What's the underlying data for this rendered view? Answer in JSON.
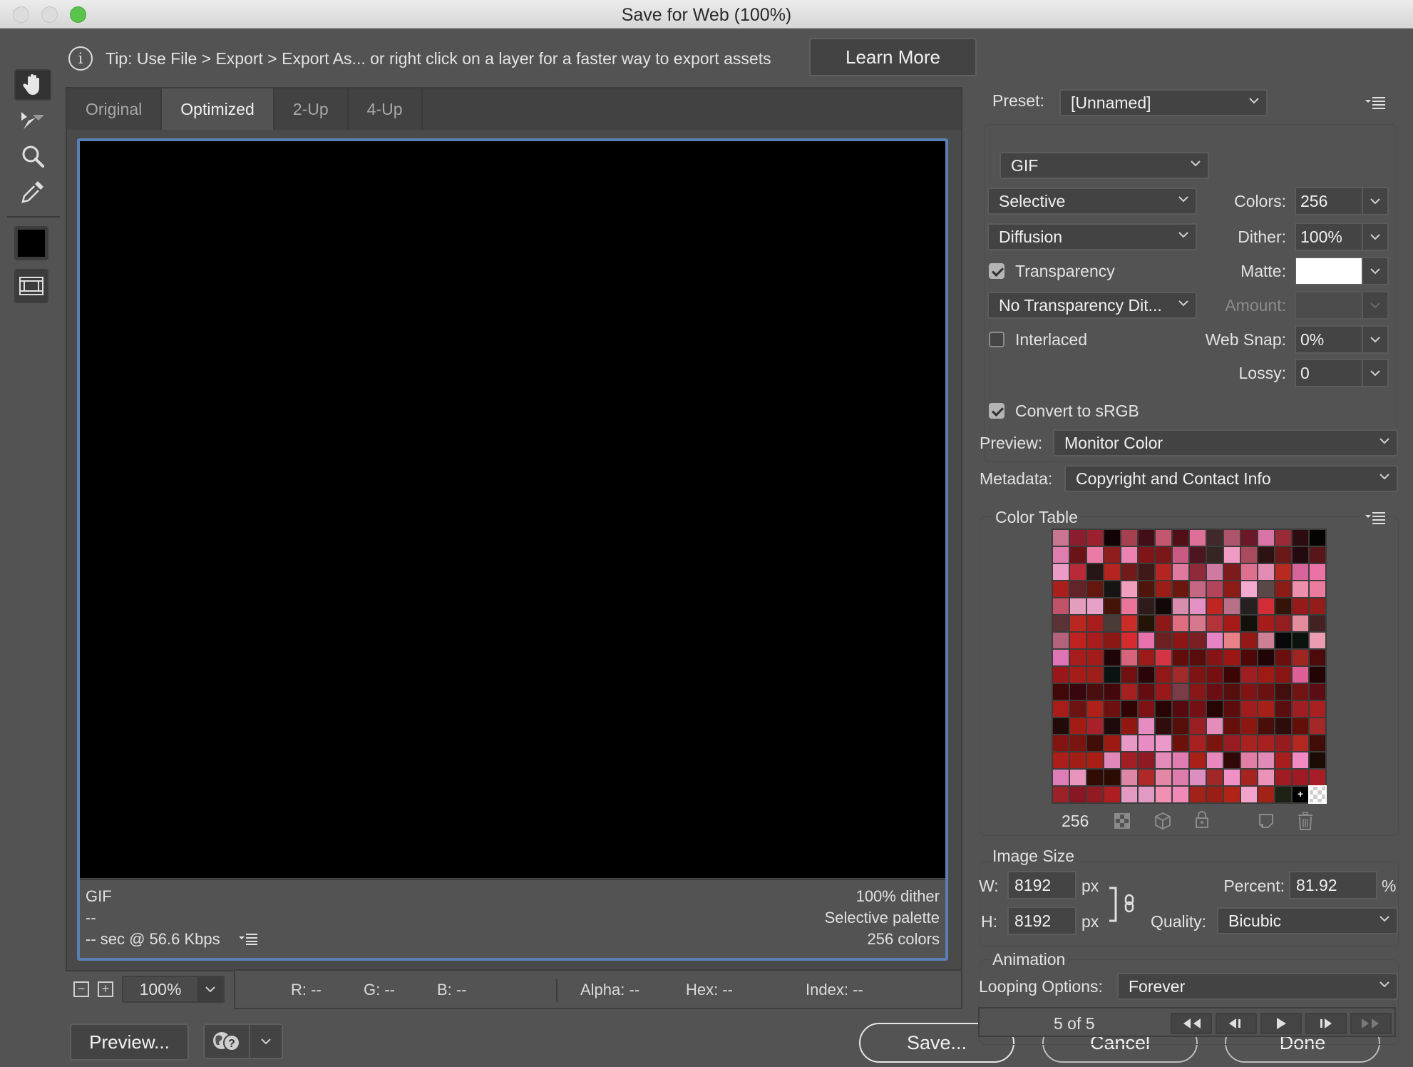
{
  "window": {
    "title": "Save for Web (100%)"
  },
  "tools": [
    {
      "name": "hand-tool",
      "active": true
    },
    {
      "name": "slice-select-tool",
      "active": false
    },
    {
      "name": "zoom-tool",
      "active": false
    },
    {
      "name": "eyedropper-tool",
      "active": false
    }
  ],
  "eyedropper_color": "#000000",
  "tip": {
    "text": "Tip: Use File > Export > Export As...  or right click on a layer for a faster way to export assets",
    "learn_more": "Learn More"
  },
  "tabs": [
    {
      "label": "Original",
      "active": false
    },
    {
      "label": "Optimized",
      "active": true
    },
    {
      "label": "2-Up",
      "active": false
    },
    {
      "label": "4-Up",
      "active": false
    }
  ],
  "preview_info": {
    "format": "GIF",
    "size": "--",
    "download": "-- sec @ 56.6 Kbps",
    "dither": "100% dither",
    "palette": "Selective palette",
    "colors": "256 colors"
  },
  "zoom": {
    "value": "100%"
  },
  "readout": {
    "r": "R: --",
    "g": "G: --",
    "b": "B: --",
    "alpha": "Alpha: --",
    "hex": "Hex: --",
    "index": "Index: --"
  },
  "buttons": {
    "preview": "Preview...",
    "save": "Save...",
    "cancel": "Cancel",
    "done": "Done"
  },
  "settings": {
    "preset_label": "Preset:",
    "preset": "[Unnamed]",
    "format": "GIF",
    "reduction": "Selective",
    "dither_algorithm": "Diffusion",
    "colors_label": "Colors:",
    "colors": "256",
    "dither_label": "Dither:",
    "dither": "100%",
    "transparency_label": "Transparency",
    "transparency": true,
    "matte_label": "Matte:",
    "matte_color": "#ffffff",
    "transparency_dither": "No Transparency Dit...",
    "amount_label": "Amount:",
    "amount": "",
    "interlaced_label": "Interlaced",
    "interlaced": false,
    "web_snap_label": "Web Snap:",
    "web_snap": "0%",
    "lossy_label": "Lossy:",
    "lossy": "0",
    "convert_srgb_label": "Convert to sRGB",
    "convert_srgb": true,
    "preview_label": "Preview:",
    "preview": "Monitor Color",
    "metadata_label": "Metadata:",
    "metadata": "Copyright and Contact Info"
  },
  "color_table": {
    "title": "Color Table",
    "count": "256",
    "colors": [
      "#c97591",
      "#8a1e2e",
      "#9b2030",
      "#120306",
      "#a6404f",
      "#430e18",
      "#c4576f",
      "#520f18",
      "#de6f99",
      "#40282b",
      "#ae546b",
      "#6b1828",
      "#db74a6",
      "#9a2a37",
      "#2c0c10",
      "#060303",
      "#de7dae",
      "#6b1418",
      "#eb7aa6",
      "#8e1d1d",
      "#eb82b1",
      "#7f1519",
      "#7c1618",
      "#c95a83",
      "#4e1520",
      "#352624",
      "#f09bc4",
      "#aa4a5d",
      "#2e1213",
      "#6b1818",
      "#240a10",
      "#58161b",
      "#ec9ac6",
      "#b82a36",
      "#261616",
      "#b42420",
      "#701a1a",
      "#401818",
      "#b42420",
      "#e0799e",
      "#8f2a39",
      "#d07aa2",
      "#7c1a1c",
      "#df6f8f",
      "#e28bb3",
      "#b82922",
      "#d6649b",
      "#ea72a5",
      "#a91f1b",
      "#632428",
      "#64170f",
      "#181414",
      "#f19dbc",
      "#4f150d",
      "#9b1d18",
      "#6b1710",
      "#c46783",
      "#b3445c",
      "#8c1a17",
      "#f3a9ce",
      "#5a4747",
      "#8a1b16",
      "#ed8ead",
      "#ea7b9c",
      "#c05369",
      "#e59dbc",
      "#e7a0c8",
      "#451408",
      "#ea749a",
      "#2f1a1c",
      "#130808",
      "#d88cae",
      "#e490c5",
      "#c02521",
      "#ba6f89",
      "#262020",
      "#d22c36",
      "#361308",
      "#961a1a",
      "#941d1c",
      "#5b3336",
      "#b82720",
      "#a81c1e",
      "#4a3a38",
      "#ca2c28",
      "#241408",
      "#8e1818",
      "#de6e7f",
      "#d7778e",
      "#b43239",
      "#a61a18",
      "#14100a",
      "#a51c1b",
      "#941d1f",
      "#e38c9e",
      "#422222",
      "#b2637b",
      "#c0231f",
      "#a81c1d",
      "#8c1816",
      "#d52b2e",
      "#e770ad",
      "#6c2020",
      "#8c1616",
      "#7c1f24",
      "#e683c4",
      "#e98087",
      "#931715",
      "#cd7f96",
      "#08080a",
      "#0a140c",
      "#eb9cb0",
      "#de74b4",
      "#a61d1c",
      "#a21c1a",
      "#1f0408",
      "#d7647b",
      "#9c1a17",
      "#d43545",
      "#620c0c",
      "#580c0c",
      "#861414",
      "#9a1714",
      "#4e0808",
      "#200408",
      "#6a0e0e",
      "#a02420",
      "#4e0a0a",
      "#9a1618",
      "#a61c18",
      "#9e1e1a",
      "#0a1212",
      "#701010",
      "#2a0408",
      "#921818",
      "#a12a2a",
      "#7f1212",
      "#760f0f",
      "#3c0404",
      "#a01e22",
      "#a01a14",
      "#891414",
      "#dc5f98",
      "#220404",
      "#420808",
      "#38060c",
      "#4a0e0e",
      "#44080c",
      "#a62020",
      "#640c10",
      "#9a181a",
      "#7a3c46",
      "#881818",
      "#6a0e14",
      "#540e0c",
      "#801414",
      "#6a1212",
      "#420e0e",
      "#721414",
      "#5c0c14",
      "#a81c1a",
      "#6c1210",
      "#ae2018",
      "#6e1010",
      "#300404",
      "#7e1214",
      "#280404",
      "#560a10",
      "#741014",
      "#280404",
      "#5c0c0c",
      "#a21c1e",
      "#a62018",
      "#5c0e0e",
      "#9e1e22",
      "#a82020",
      "#220a0a",
      "#a21c14",
      "#a8202a",
      "#1e0a0a",
      "#901810",
      "#e68cc0",
      "#300c0c",
      "#560e0a",
      "#9a1e22",
      "#e68cba",
      "#660e0a",
      "#8c1610",
      "#4a0e08",
      "#2e0c0c",
      "#640e08",
      "#a42828",
      "#821412",
      "#7a140e",
      "#420c08",
      "#9c1a12",
      "#e898c4",
      "#ea8cc4",
      "#ec98c8",
      "#6e100c",
      "#a82020",
      "#7c140e",
      "#961c22",
      "#a82220",
      "#a82020",
      "#961a1e",
      "#b02820",
      "#420c08",
      "#ac1e1a",
      "#a01e16",
      "#a81e14",
      "#e088b8",
      "#a01e24",
      "#8e1a24",
      "#e48ab8",
      "#e07cb2",
      "#a82018",
      "#e888bc",
      "#300808",
      "#e07ea6",
      "#e08ab8",
      "#a81e1e",
      "#f08ac0",
      "#1c0c06",
      "#de7cb8",
      "#e894bc",
      "#300c04",
      "#2a0c04",
      "#de86a6",
      "#b02828",
      "#e486a6",
      "#de7cae",
      "#dc8ec0",
      "#a22828",
      "#f090c4",
      "#a62420",
      "#ea92b8",
      "#a01c22",
      "#a01a24",
      "#a81e28",
      "#9a2228",
      "#861824",
      "#921a22",
      "#ac1e22",
      "#e29ac0",
      "#e09ac4",
      "#f090b2",
      "#f088b8",
      "#a02218",
      "#9a1e16",
      "#b02418",
      "#f4a4cc",
      "#a22216",
      "#1c2214",
      "#000000",
      "transparent"
    ]
  },
  "image_size": {
    "title": "Image Size",
    "w_label": "W:",
    "width": "8192",
    "h_label": "H:",
    "height": "8192",
    "unit": "px",
    "percent_label": "Percent:",
    "percent": "81.92",
    "percent_unit": "%",
    "quality_label": "Quality:",
    "quality": "Bicubic"
  },
  "animation": {
    "title": "Animation",
    "looping_label": "Looping Options:",
    "looping": "Forever",
    "frame_counter": "5 of 5"
  }
}
